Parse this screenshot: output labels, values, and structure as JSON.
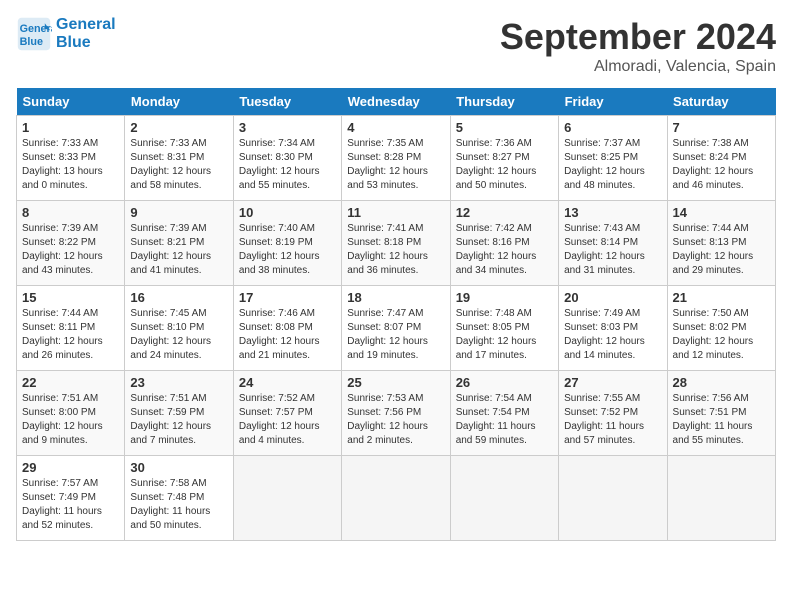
{
  "header": {
    "logo_line1": "General",
    "logo_line2": "Blue",
    "month": "September 2024",
    "location": "Almoradi, Valencia, Spain"
  },
  "days_of_week": [
    "Sunday",
    "Monday",
    "Tuesday",
    "Wednesday",
    "Thursday",
    "Friday",
    "Saturday"
  ],
  "weeks": [
    [
      {
        "day": "1",
        "sunrise": "Sunrise: 7:33 AM",
        "sunset": "Sunset: 8:33 PM",
        "daylight": "Daylight: 13 hours and 0 minutes."
      },
      {
        "day": "2",
        "sunrise": "Sunrise: 7:33 AM",
        "sunset": "Sunset: 8:31 PM",
        "daylight": "Daylight: 12 hours and 58 minutes."
      },
      {
        "day": "3",
        "sunrise": "Sunrise: 7:34 AM",
        "sunset": "Sunset: 8:30 PM",
        "daylight": "Daylight: 12 hours and 55 minutes."
      },
      {
        "day": "4",
        "sunrise": "Sunrise: 7:35 AM",
        "sunset": "Sunset: 8:28 PM",
        "daylight": "Daylight: 12 hours and 53 minutes."
      },
      {
        "day": "5",
        "sunrise": "Sunrise: 7:36 AM",
        "sunset": "Sunset: 8:27 PM",
        "daylight": "Daylight: 12 hours and 50 minutes."
      },
      {
        "day": "6",
        "sunrise": "Sunrise: 7:37 AM",
        "sunset": "Sunset: 8:25 PM",
        "daylight": "Daylight: 12 hours and 48 minutes."
      },
      {
        "day": "7",
        "sunrise": "Sunrise: 7:38 AM",
        "sunset": "Sunset: 8:24 PM",
        "daylight": "Daylight: 12 hours and 46 minutes."
      }
    ],
    [
      {
        "day": "8",
        "sunrise": "Sunrise: 7:39 AM",
        "sunset": "Sunset: 8:22 PM",
        "daylight": "Daylight: 12 hours and 43 minutes."
      },
      {
        "day": "9",
        "sunrise": "Sunrise: 7:39 AM",
        "sunset": "Sunset: 8:21 PM",
        "daylight": "Daylight: 12 hours and 41 minutes."
      },
      {
        "day": "10",
        "sunrise": "Sunrise: 7:40 AM",
        "sunset": "Sunset: 8:19 PM",
        "daylight": "Daylight: 12 hours and 38 minutes."
      },
      {
        "day": "11",
        "sunrise": "Sunrise: 7:41 AM",
        "sunset": "Sunset: 8:18 PM",
        "daylight": "Daylight: 12 hours and 36 minutes."
      },
      {
        "day": "12",
        "sunrise": "Sunrise: 7:42 AM",
        "sunset": "Sunset: 8:16 PM",
        "daylight": "Daylight: 12 hours and 34 minutes."
      },
      {
        "day": "13",
        "sunrise": "Sunrise: 7:43 AM",
        "sunset": "Sunset: 8:14 PM",
        "daylight": "Daylight: 12 hours and 31 minutes."
      },
      {
        "day": "14",
        "sunrise": "Sunrise: 7:44 AM",
        "sunset": "Sunset: 8:13 PM",
        "daylight": "Daylight: 12 hours and 29 minutes."
      }
    ],
    [
      {
        "day": "15",
        "sunrise": "Sunrise: 7:44 AM",
        "sunset": "Sunset: 8:11 PM",
        "daylight": "Daylight: 12 hours and 26 minutes."
      },
      {
        "day": "16",
        "sunrise": "Sunrise: 7:45 AM",
        "sunset": "Sunset: 8:10 PM",
        "daylight": "Daylight: 12 hours and 24 minutes."
      },
      {
        "day": "17",
        "sunrise": "Sunrise: 7:46 AM",
        "sunset": "Sunset: 8:08 PM",
        "daylight": "Daylight: 12 hours and 21 minutes."
      },
      {
        "day": "18",
        "sunrise": "Sunrise: 7:47 AM",
        "sunset": "Sunset: 8:07 PM",
        "daylight": "Daylight: 12 hours and 19 minutes."
      },
      {
        "day": "19",
        "sunrise": "Sunrise: 7:48 AM",
        "sunset": "Sunset: 8:05 PM",
        "daylight": "Daylight: 12 hours and 17 minutes."
      },
      {
        "day": "20",
        "sunrise": "Sunrise: 7:49 AM",
        "sunset": "Sunset: 8:03 PM",
        "daylight": "Daylight: 12 hours and 14 minutes."
      },
      {
        "day": "21",
        "sunrise": "Sunrise: 7:50 AM",
        "sunset": "Sunset: 8:02 PM",
        "daylight": "Daylight: 12 hours and 12 minutes."
      }
    ],
    [
      {
        "day": "22",
        "sunrise": "Sunrise: 7:51 AM",
        "sunset": "Sunset: 8:00 PM",
        "daylight": "Daylight: 12 hours and 9 minutes."
      },
      {
        "day": "23",
        "sunrise": "Sunrise: 7:51 AM",
        "sunset": "Sunset: 7:59 PM",
        "daylight": "Daylight: 12 hours and 7 minutes."
      },
      {
        "day": "24",
        "sunrise": "Sunrise: 7:52 AM",
        "sunset": "Sunset: 7:57 PM",
        "daylight": "Daylight: 12 hours and 4 minutes."
      },
      {
        "day": "25",
        "sunrise": "Sunrise: 7:53 AM",
        "sunset": "Sunset: 7:56 PM",
        "daylight": "Daylight: 12 hours and 2 minutes."
      },
      {
        "day": "26",
        "sunrise": "Sunrise: 7:54 AM",
        "sunset": "Sunset: 7:54 PM",
        "daylight": "Daylight: 11 hours and 59 minutes."
      },
      {
        "day": "27",
        "sunrise": "Sunrise: 7:55 AM",
        "sunset": "Sunset: 7:52 PM",
        "daylight": "Daylight: 11 hours and 57 minutes."
      },
      {
        "day": "28",
        "sunrise": "Sunrise: 7:56 AM",
        "sunset": "Sunset: 7:51 PM",
        "daylight": "Daylight: 11 hours and 55 minutes."
      }
    ],
    [
      {
        "day": "29",
        "sunrise": "Sunrise: 7:57 AM",
        "sunset": "Sunset: 7:49 PM",
        "daylight": "Daylight: 11 hours and 52 minutes."
      },
      {
        "day": "30",
        "sunrise": "Sunrise: 7:58 AM",
        "sunset": "Sunset: 7:48 PM",
        "daylight": "Daylight: 11 hours and 50 minutes."
      },
      null,
      null,
      null,
      null,
      null
    ]
  ]
}
